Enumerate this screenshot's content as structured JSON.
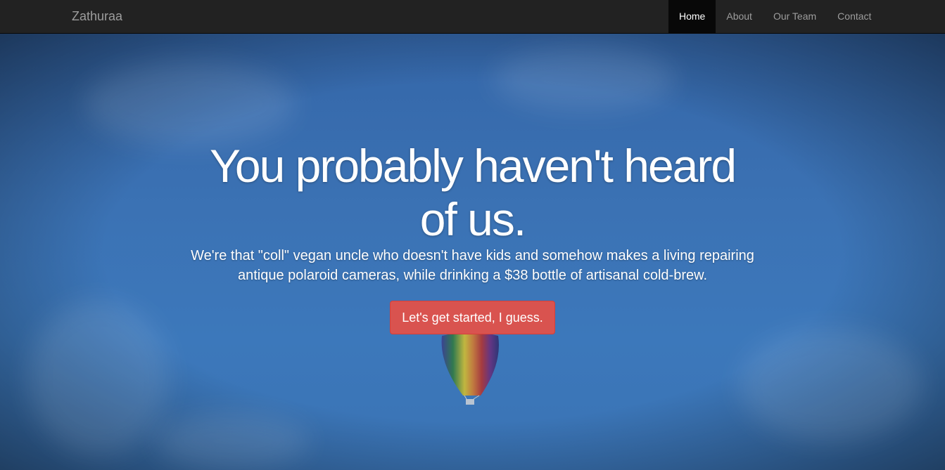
{
  "navbar": {
    "brand": "Zathuraa",
    "items": [
      {
        "label": "Home",
        "active": true
      },
      {
        "label": "About",
        "active": false
      },
      {
        "label": "Our Team",
        "active": false
      },
      {
        "label": "Contact",
        "active": false
      }
    ]
  },
  "hero": {
    "title": "You probably haven't heard of us.",
    "subtitle": "We're that \"coll\" vegan uncle who doesn't have kids and somehow makes a living repairing antique polaroid cameras, while drinking a $38 bottle of artisanal cold-brew.",
    "cta_label": "Let's get started, I guess."
  },
  "colors": {
    "navbar_bg": "#222222",
    "sky": "#3b72b4",
    "cta": "#d9534f"
  }
}
